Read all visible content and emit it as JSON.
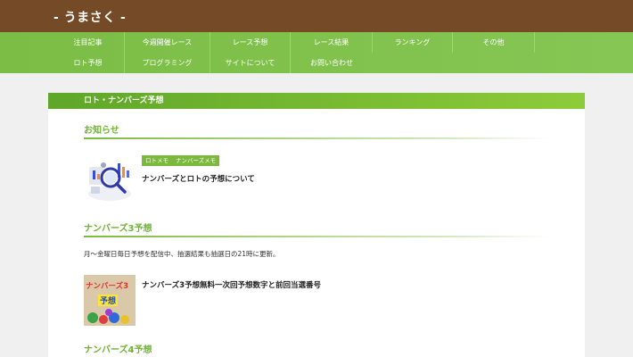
{
  "site": {
    "title": "- うまさく -"
  },
  "nav": {
    "row1": [
      "注目記事",
      "今週開催レース",
      "レース予想",
      "レース結果",
      "ランキング",
      "その他"
    ],
    "row2": [
      "ロト予想",
      "プログラミング",
      "サイトについて",
      "お問い合わせ"
    ]
  },
  "page": {
    "section_title": "ロト・ナンバーズ予想",
    "news": {
      "heading": "お知らせ",
      "post": {
        "tags": [
          "ロトメモ",
          "ナンバーズメモ"
        ],
        "title": "ナンバーズとロトの予想について"
      }
    },
    "numbers3": {
      "heading": "ナンバーズ3予想",
      "description": "月〜金曜日毎日予想を配信中、抽選結果も抽選日の21時に更新。",
      "post": {
        "title": "ナンバーズ3予想無料一次回予想数字と前回当選番号",
        "thumb_text_1": "ナンバーズ3",
        "thumb_text_2": "予想"
      }
    },
    "numbers4": {
      "heading": "ナンバーズ4予想"
    }
  },
  "colors": {
    "header_bg": "#744b26",
    "nav_bg": "#7bbd45",
    "accent_green": "#6fb332",
    "tag_bg": "#7ab93c"
  }
}
